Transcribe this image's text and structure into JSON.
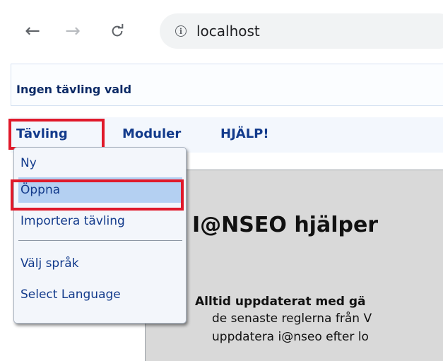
{
  "browser": {
    "back_icon": "←",
    "forward_icon": "→",
    "reload_icon": "C",
    "info_icon": "i",
    "url": "localhost"
  },
  "page": {
    "competition_status": "Ingen tävling vald",
    "menu": [
      "Tävling",
      "Moduler",
      "HJÄLP!"
    ],
    "dropdown": {
      "items": [
        "Ny",
        "Öppna",
        "Importera tävling",
        "Välj språk",
        "Select Language"
      ],
      "active_item": "Öppna"
    },
    "content": {
      "title": "I@NSEO hjälper",
      "line1": "Alltid uppdaterat med gä",
      "line2": "de senaste reglerna från V",
      "line3": "uppdatera i@nseo efter lo"
    },
    "highlight_color": "#e0192a"
  }
}
